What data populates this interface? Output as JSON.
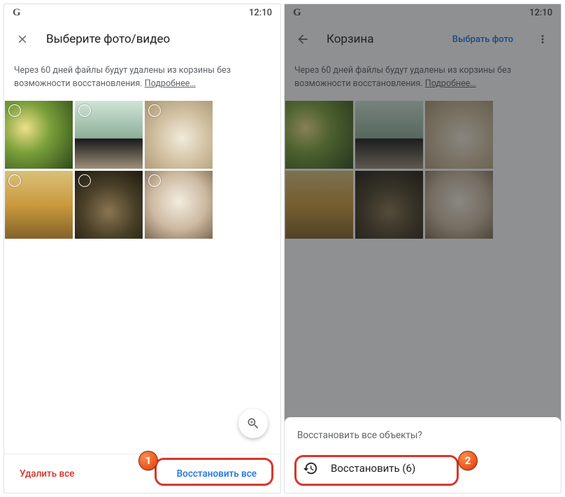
{
  "status": {
    "logo": "G",
    "time": "12:10"
  },
  "left": {
    "title": "Выберите фото/видео",
    "notice_text": "Через 60 дней файлы будут удалены из корзины без возможности восстановления. ",
    "notice_link": "Подробнее…",
    "delete_all": "Удалить все",
    "restore_all": "Восстановить все",
    "badge": "1"
  },
  "right": {
    "title": "Корзина",
    "select_photo": "Выбрать фото",
    "notice_text": "Через 60 дней файлы будут удалены из корзины без возможности восстановления. ",
    "notice_link": "Подробнее…",
    "sheet_question": "Восстановить все объекты?",
    "sheet_action": "Восстановить (6)",
    "badge": "2"
  }
}
